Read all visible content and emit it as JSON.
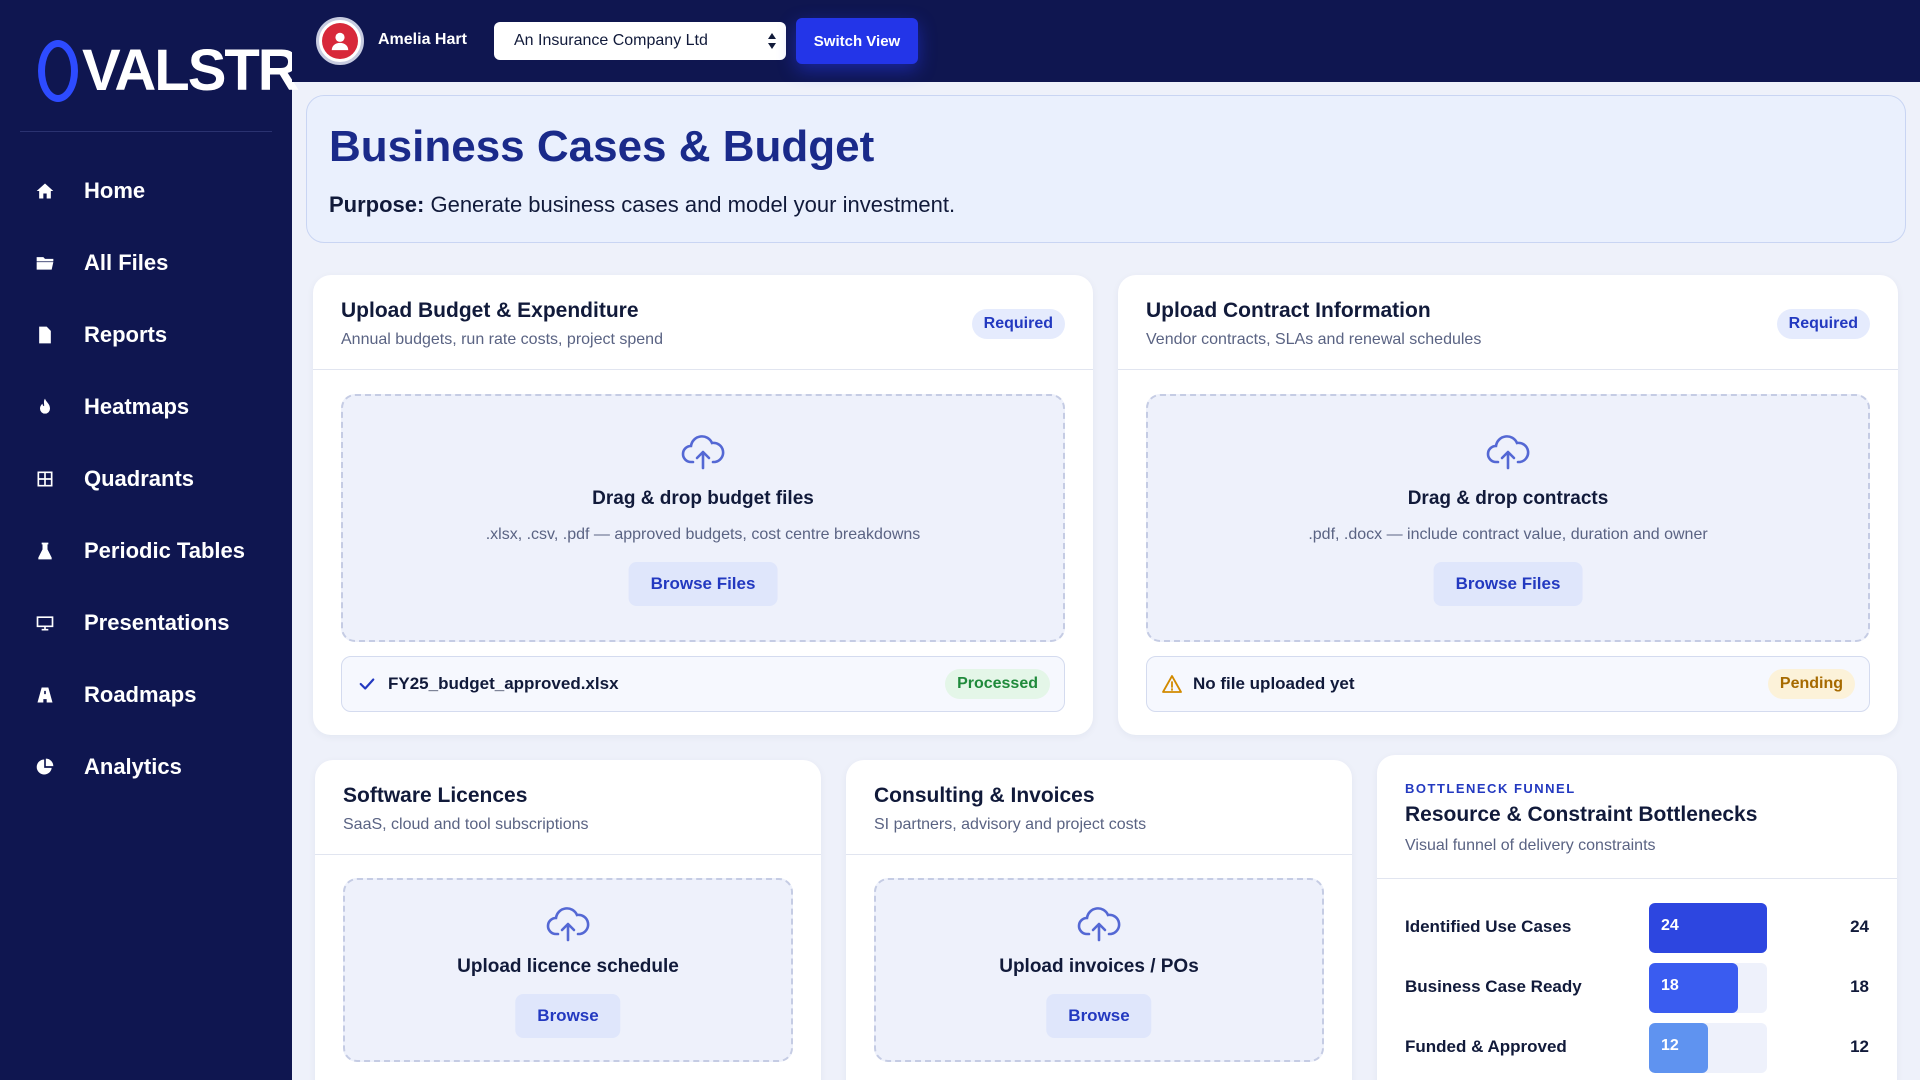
{
  "brand": {
    "logo_text": "VALSTR",
    "accent": "#2d4bff",
    "sidebar_bg": "#0f1650"
  },
  "sidebar": {
    "items": [
      {
        "label": "Home",
        "icon": "home-icon"
      },
      {
        "label": "All Files",
        "icon": "folder-icon"
      },
      {
        "label": "Reports",
        "icon": "document-icon"
      },
      {
        "label": "Heatmaps",
        "icon": "flame-icon"
      },
      {
        "label": "Quadrants",
        "icon": "grid-icon"
      },
      {
        "label": "Periodic Tables",
        "icon": "flask-icon"
      },
      {
        "label": "Presentations",
        "icon": "monitor-icon"
      },
      {
        "label": "Roadmaps",
        "icon": "road-icon"
      },
      {
        "label": "Analytics",
        "icon": "pie-chart-icon"
      }
    ]
  },
  "topbar": {
    "user_name": "Amelia Hart",
    "company_selected": "An Insurance Company Ltd",
    "switch_label": "Switch View"
  },
  "header": {
    "title": "Business Cases & Budget",
    "purpose_label": "Purpose:",
    "purpose_text": " Generate business cases and model your investment."
  },
  "budget_card": {
    "title": "Upload Budget & Expenditure",
    "subtitle": "Annual budgets, run rate costs, project spend",
    "badge": "Required",
    "dropzone_title": "Drag & drop budget files",
    "dropzone_hint": ".xlsx, .csv, .pdf — approved budgets, cost centre breakdowns",
    "browse_label": "Browse Files",
    "file_name": "FY25_budget_approved.xlsx",
    "file_status": "Processed",
    "status_color": "#1f8a3b"
  },
  "contract_card": {
    "title": "Upload Contract Information",
    "subtitle": "Vendor contracts, SLAs and renewal schedules",
    "badge": "Required",
    "dropzone_title": "Drag & drop contracts",
    "dropzone_hint": ".pdf, .docx — include contract value, duration and owner",
    "browse_label": "Browse Files",
    "file_name": "No file uploaded yet",
    "file_status": "Pending",
    "status_color": "#a66a00"
  },
  "licences_card": {
    "title": "Software Licences",
    "subtitle": "SaaS, cloud and tool subscriptions",
    "dropzone_title": "Upload licence schedule",
    "browse_label": "Browse"
  },
  "consulting_card": {
    "title": "Consulting & Invoices",
    "subtitle": "SI partners, advisory and project costs",
    "dropzone_title": "Upload invoices / POs",
    "browse_label": "Browse"
  },
  "funnel": {
    "eyebrow": "BOTTLENECK FUNNEL",
    "title": "Resource & Constraint Bottlenecks",
    "subtitle": "Visual funnel of delivery constraints",
    "max": 24,
    "rows": [
      {
        "label": "Identified Use Cases",
        "value": 24,
        "display": "24",
        "color": "#2d46e0"
      },
      {
        "label": "Business Case Ready",
        "value": 18,
        "display": "18",
        "color": "#3a5cf0"
      },
      {
        "label": "Funded & Approved",
        "value": 12,
        "display": "12",
        "color": "#5f93f0"
      }
    ]
  }
}
